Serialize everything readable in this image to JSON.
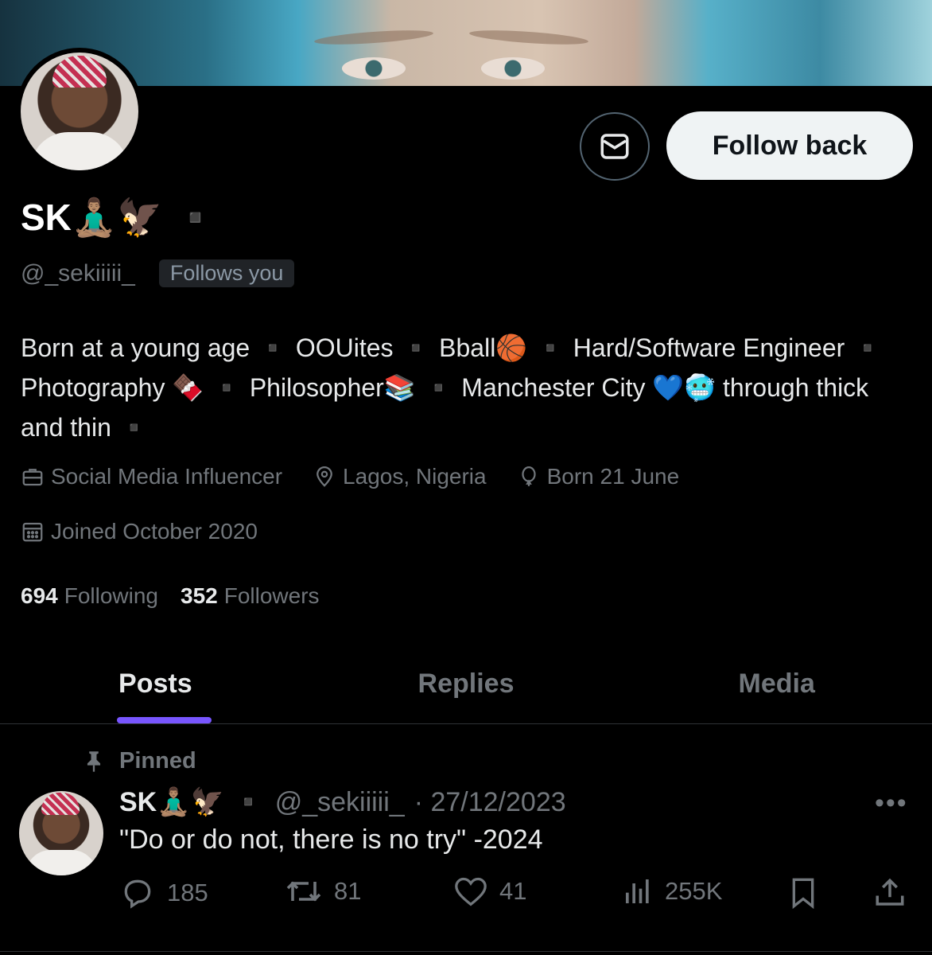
{
  "profile": {
    "display_name": "SK🧘🏽‍♂️🦅 ▪️",
    "handle": "@_sekiiiii_",
    "follows_you_badge": "Follows you",
    "bio": "Born at a young age ▪️ OOUites ▪️ Bball🏀 ▪️ Hard/Software Engineer ▪️ Photography 🍫 ▪️ Philosopher📚 ▪️ Manchester City 💙🥶 through thick and thin ▪️",
    "occupation": "Social Media Influencer",
    "location": "Lagos, Nigeria",
    "birthday": "Born 21 June",
    "joined": "Joined October 2020",
    "following_count": "694",
    "following_label": "Following",
    "followers_count": "352",
    "followers_label": "Followers"
  },
  "actions": {
    "follow_back_label": "Follow back",
    "message_icon": "mail-icon"
  },
  "tabs": [
    {
      "label": "Posts",
      "active": true
    },
    {
      "label": "Replies",
      "active": false
    },
    {
      "label": "Media",
      "active": false
    }
  ],
  "pinned_post": {
    "pinned_label": "Pinned",
    "author_name": "SK🧘🏽‍♂️🦅 ▪️",
    "handle": "@_sekiiiii_",
    "date": "· 27/12/2023",
    "text": "\"Do or do not, there is no try\" -2024",
    "more_icon": "•••",
    "replies": "185",
    "reposts": "81",
    "likes": "41",
    "views": "255K"
  },
  "colors": {
    "background": "#000000",
    "text_primary": "#e7e9ea",
    "text_secondary": "#71767b",
    "tab_accent": "#7856ff",
    "follow_button_bg": "#eff3f4"
  }
}
